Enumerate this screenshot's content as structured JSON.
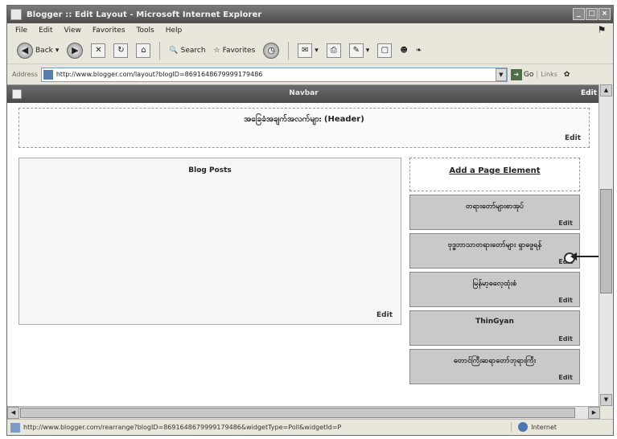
{
  "window": {
    "title": "Blogger :: Edit Layout - Microsoft Internet Explorer"
  },
  "menu": {
    "items": [
      "File",
      "Edit",
      "View",
      "Favorites",
      "Tools",
      "Help"
    ]
  },
  "toolbar": {
    "back_label": "Back",
    "search_label": "Search",
    "favorites_label": "Favorites"
  },
  "address": {
    "label": "Address",
    "url": "http://www.blogger.com/layout?blogID=8691648679999179486",
    "go_label": "Go",
    "links_label": "Links"
  },
  "navbar": {
    "title": "Navbar",
    "edit": "Edit"
  },
  "header": {
    "title": "အခြေခံအချက်အလက်များ (Header)",
    "edit": "Edit"
  },
  "posts": {
    "title": "Blog Posts",
    "edit": "Edit"
  },
  "add_element": {
    "label": "Add a Page Element"
  },
  "gadgets": [
    {
      "title": "တရားတော်များစာအုပ်",
      "edit": "Edit"
    },
    {
      "title": "ဗုဒ္ဓဘာသာတရားတော်များ ရှာဖွေရန်",
      "edit": "Edit"
    },
    {
      "title": "မြန်မာ့ဓလေ့ထုံးစံ",
      "edit": "Edit"
    },
    {
      "title": "ThinGyan",
      "edit": "Edit"
    },
    {
      "title": "တောင်ကြီးဆရာတော်ဘုရားကြီး",
      "edit": "Edit"
    }
  ],
  "status": {
    "url": "http://www.blogger.com/rearrange?blogID=8691648679999179486&widgetType=Poll&widgetId=P",
    "zone": "Internet"
  }
}
